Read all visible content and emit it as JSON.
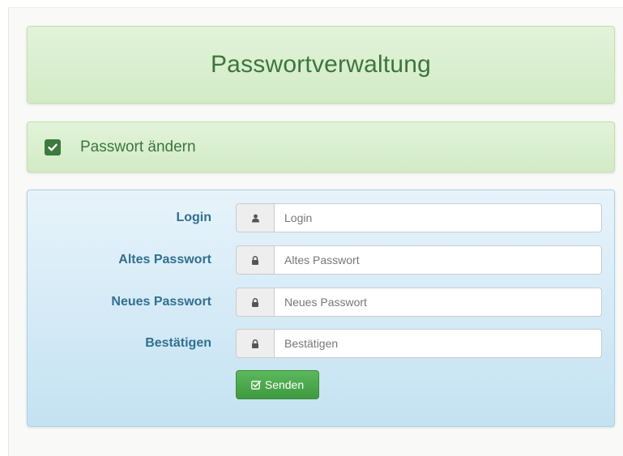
{
  "header": {
    "title": "Passwortverwaltung"
  },
  "section": {
    "checkbox_icon": "checkbox-checked-icon",
    "label": "Passwort ändern"
  },
  "form": {
    "fields": [
      {
        "label": "Login",
        "placeholder": "Login",
        "value": "",
        "icon": "user-icon"
      },
      {
        "label": "Altes Passwort",
        "placeholder": "Altes Passwort",
        "value": "",
        "icon": "lock-icon"
      },
      {
        "label": "Neues Passwort",
        "placeholder": "Neues Passwort",
        "value": "",
        "icon": "lock-icon"
      },
      {
        "label": "Bestätigen",
        "placeholder": "Bestätigen",
        "value": "",
        "icon": "lock-icon"
      }
    ],
    "submit": {
      "label": "Senden",
      "icon": "check-square-icon"
    }
  },
  "colors": {
    "success_text": "#3c763d",
    "info_text": "#31708f",
    "button_green": "#5cb85c"
  }
}
